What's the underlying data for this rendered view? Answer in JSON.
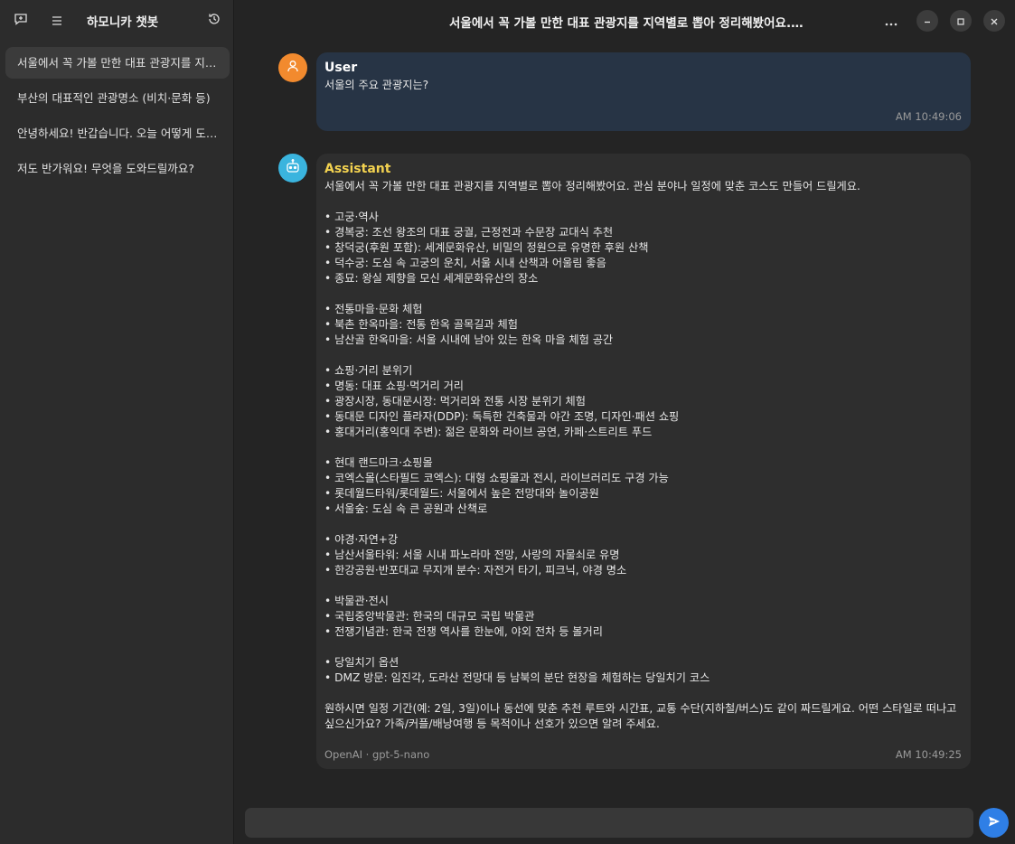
{
  "app": {
    "title": "하모니카 챗봇"
  },
  "sidebar": {
    "conversations": [
      {
        "label": "서울에서 꼭 가볼 만한 대표 관광지를 지역별로 뽑아 정리해봤어요."
      },
      {
        "label": "부산의 대표적인 관광명소 (비치·문화 등)"
      },
      {
        "label": "안녕하세요! 반갑습니다. 오늘 어떻게 도와드릴까요?"
      },
      {
        "label": "저도 반가워요! 무엇을 도와드릴까요?"
      }
    ]
  },
  "header": {
    "chat_title": "서울에서 꼭 가볼 만한 대표 관광지를 지역별로 뽑아 정리해봤어요. 관심 분야나 일정에 맞춘 코스도"
  },
  "messages": {
    "user": {
      "sender": "User",
      "text": "서울의 주요 관광지는?",
      "time": "AM 10:49:06"
    },
    "assistant": {
      "sender": "Assistant",
      "lines": [
        "서울에서 꼭 가볼 만한 대표 관광지를 지역별로 뽑아 정리해봤어요. 관심 분야나 일정에 맞춘 코스도 만들어 드릴게요.",
        "",
        "• 고궁·역사",
        "• 경복궁: 조선 왕조의 대표 궁궐, 근정전과 수문장 교대식 추천",
        "• 창덕궁(후원 포함): 세계문화유산, 비밀의 정원으로 유명한 후원 산책",
        "• 덕수궁: 도심 속 고궁의 운치, 서울 시내 산책과 어울림 좋음",
        "• 종묘: 왕실 제향을 모신 세계문화유산의 장소",
        "",
        "• 전통마을·문화 체험",
        "• 북촌 한옥마을: 전통 한옥 골목길과 체험",
        "• 남산골 한옥마을: 서울 시내에 남아 있는 한옥 마을 체험 공간",
        "",
        "• 쇼핑·거리 분위기",
        "• 명동: 대표 쇼핑·먹거리 거리",
        "• 광장시장, 동대문시장: 먹거리와 전통 시장 분위기 체험",
        "• 동대문 디자인 플라자(DDP): 독특한 건축물과 야간 조명, 디자인·패션 쇼핑",
        "• 홍대거리(홍익대 주변): 젊은 문화와 라이브 공연, 카페·스트리트 푸드",
        "",
        "• 현대 랜드마크·쇼핑몰",
        "• 코엑스몰(스타필드 코엑스): 대형 쇼핑몰과 전시, 라이브러리도 구경 가능",
        "• 롯데월드타워/롯데월드: 서울에서 높은 전망대와 놀이공원",
        "• 서울숲: 도심 속 큰 공원과 산책로",
        "",
        "• 야경·자연+강",
        "• 남산서울타워: 서울 시내 파노라마 전망, 사랑의 자물쇠로 유명",
        "• 한강공원·반포대교 무지개 분수: 자전거 타기, 피크닉, 야경 명소",
        "",
        "• 박물관·전시",
        "• 국립중앙박물관: 한국의 대규모 국립 박물관",
        "• 전쟁기념관: 한국 전쟁 역사를 한눈에, 야외 전차 등 볼거리",
        "",
        "• 당일치기 옵션",
        "• DMZ 방문: 임진각, 도라산 전망대 등 남북의 분단 현장을 체험하는 당일치기 코스",
        ""
      ],
      "outro": "원하시면 일정 기간(예: 2일, 3일)이나 동선에 맞춘 추천 루트와 시간표, 교통 수단(지하철/버스)도 같이 짜드릴게요. 어떤 스타일로 떠나고 싶으신가요? 가족/커플/배낭여행 등 목적이나 선호가 있으면 알려 주세요.",
      "meta": "OpenAI · gpt-5-nano",
      "time": "AM 10:49:25"
    }
  },
  "composer": {
    "placeholder": ""
  },
  "icons": {
    "new_chat": "chat-plus-icon",
    "menu": "hamburger-icon",
    "history": "history-icon",
    "more": "ellipsis-icon",
    "minimize": "minimize-icon",
    "maximize": "maximize-icon",
    "close": "close-icon",
    "send": "send-icon"
  },
  "colors": {
    "user_bubble": "#273445",
    "assistant_bubble": "#2e2e2e",
    "assistant_name": "#f3d250",
    "send_button": "#2f7fe6"
  }
}
